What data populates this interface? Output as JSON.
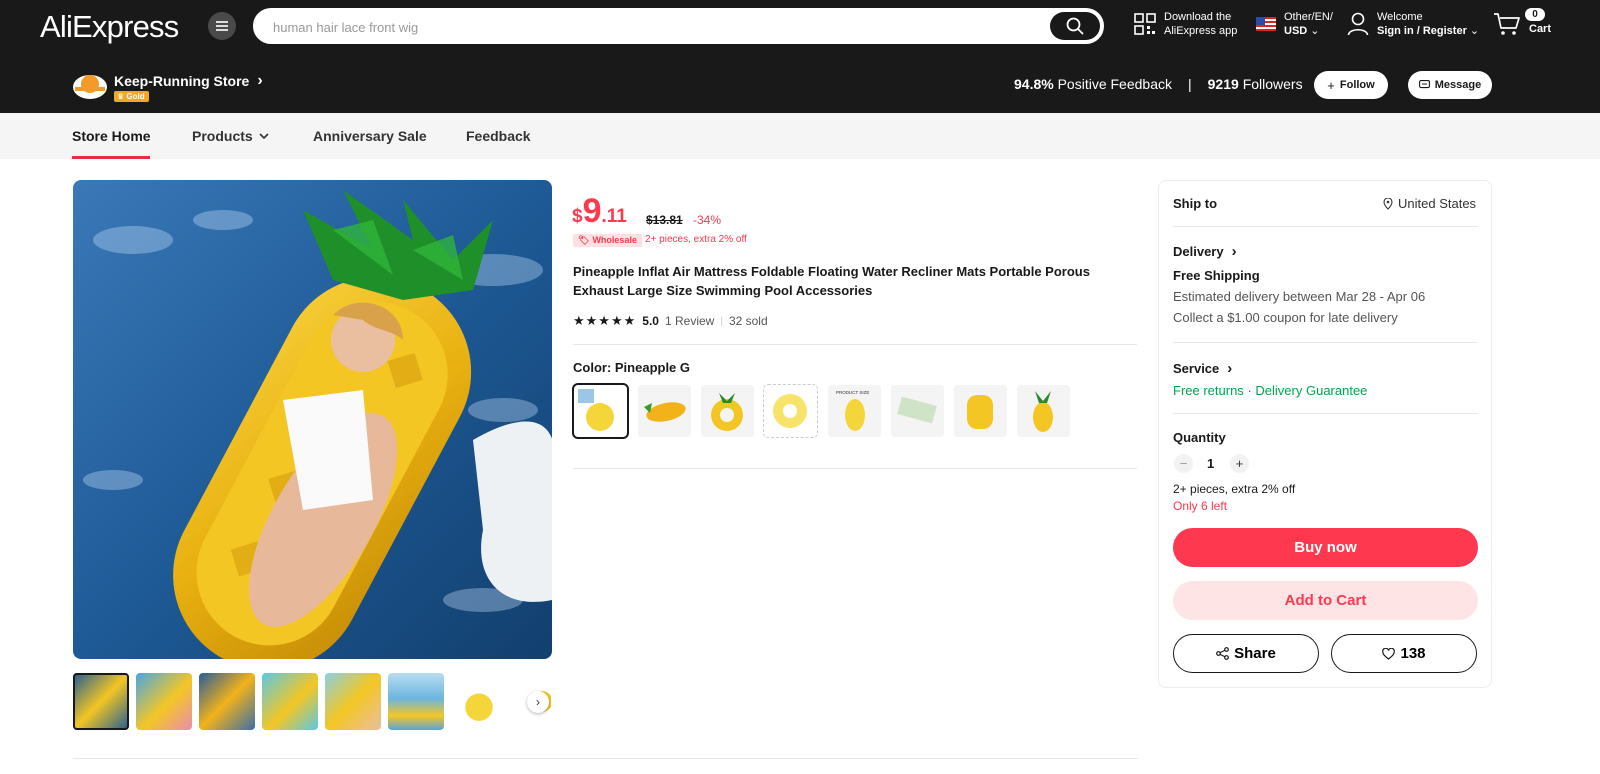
{
  "header": {
    "logo": "AliExpress",
    "search_placeholder": "human hair lace front wig",
    "download_line1": "Download the",
    "download_line2": "AliExpress app",
    "region_line1": "Other/EN/",
    "region_line2": "USD",
    "welcome": "Welcome",
    "signin": "Sign in / Register",
    "cart_label": "Cart",
    "cart_count": "0"
  },
  "store": {
    "name": "Keep-Running Store",
    "badge": "Gold",
    "positive_pct": "94.8%",
    "positive_label": "Positive Feedback",
    "followers_count": "9219",
    "followers_label": "Followers",
    "follow_label": "Follow",
    "message_label": "Message"
  },
  "nav": {
    "items": [
      "Store Home",
      "Products",
      "Anniversary Sale",
      "Feedback"
    ]
  },
  "product": {
    "currency": "$",
    "price_int": "9",
    "price_dec": ".11",
    "old_price": "$13.81",
    "discount": "-34%",
    "wholesale_tag": "Wholesale",
    "wholesale_note": "2+ pieces, extra 2% off",
    "title": "Pineapple Inflat Air Mattress Foldable Floating Water Recliner Mats Portable Porous Exhaust Large Size Swimming Pool Accessories",
    "rating": "5.0",
    "reviews": "1 Review",
    "sold": "32 sold",
    "color_label": "Color: Pineapple G",
    "swatch_size_caption": "PRODUCT SIZE"
  },
  "panel": {
    "ship_to_label": "Ship to",
    "ship_to_value": "United States",
    "delivery_label": "Delivery",
    "free_shipping": "Free Shipping",
    "estimated": "Estimated delivery between Mar 28 - Apr 06",
    "coupon": "Collect a $1.00 coupon for late delivery",
    "service_label": "Service",
    "free_returns": "Free returns",
    "dot": "·",
    "guarantee": "Delivery Guarantee",
    "quantity_label": "Quantity",
    "quantity_value": "1",
    "qty_note": "2+ pieces, extra 2% off",
    "stock_note": "Only 6 left",
    "buy_now": "Buy now",
    "add_to_cart": "Add to Cart",
    "share": "Share",
    "wishlist_count": "138"
  },
  "colors": {
    "accent": "#fd384f",
    "header_bg": "#191919",
    "green": "#00a651"
  }
}
